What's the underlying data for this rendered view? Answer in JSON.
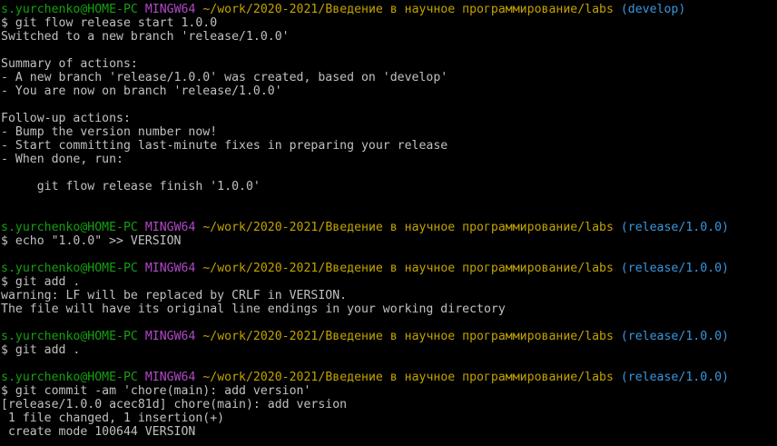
{
  "colors": {
    "background": "#000000",
    "text": "#c0c0c0",
    "user": "#13a10e",
    "host": "#b148c6",
    "path": "#c1a300",
    "branch": "#3a96dd"
  },
  "lines": [
    {
      "type": "prompt",
      "user": "s.yurchenko@HOME-PC",
      "host": "MINGW64",
      "path": "~/work/2020-2021/Введение в научное программирование/labs",
      "branch": "(develop)"
    },
    {
      "type": "cmd",
      "text": "$ git flow release start 1.0.0"
    },
    {
      "type": "out",
      "text": "Switched to a new branch 'release/1.0.0'"
    },
    {
      "type": "out",
      "text": ""
    },
    {
      "type": "out",
      "text": "Summary of actions:"
    },
    {
      "type": "out",
      "text": "- A new branch 'release/1.0.0' was created, based on 'develop'"
    },
    {
      "type": "out",
      "text": "- You are now on branch 'release/1.0.0'"
    },
    {
      "type": "out",
      "text": ""
    },
    {
      "type": "out",
      "text": "Follow-up actions:"
    },
    {
      "type": "out",
      "text": "- Bump the version number now!"
    },
    {
      "type": "out",
      "text": "- Start committing last-minute fixes in preparing your release"
    },
    {
      "type": "out",
      "text": "- When done, run:"
    },
    {
      "type": "out",
      "text": ""
    },
    {
      "type": "out",
      "text": "     git flow release finish '1.0.0'"
    },
    {
      "type": "out",
      "text": ""
    },
    {
      "type": "out",
      "text": ""
    },
    {
      "type": "prompt",
      "user": "s.yurchenko@HOME-PC",
      "host": "MINGW64",
      "path": "~/work/2020-2021/Введение в научное программирование/labs",
      "branch": "(release/1.0.0)"
    },
    {
      "type": "cmd",
      "text": "$ echo \"1.0.0\" >> VERSION"
    },
    {
      "type": "out",
      "text": ""
    },
    {
      "type": "prompt",
      "user": "s.yurchenko@HOME-PC",
      "host": "MINGW64",
      "path": "~/work/2020-2021/Введение в научное программирование/labs",
      "branch": "(release/1.0.0)"
    },
    {
      "type": "cmd",
      "text": "$ git add ."
    },
    {
      "type": "out",
      "text": "warning: LF will be replaced by CRLF in VERSION."
    },
    {
      "type": "out",
      "text": "The file will have its original line endings in your working directory"
    },
    {
      "type": "out",
      "text": ""
    },
    {
      "type": "prompt",
      "user": "s.yurchenko@HOME-PC",
      "host": "MINGW64",
      "path": "~/work/2020-2021/Введение в научное программирование/labs",
      "branch": "(release/1.0.0)"
    },
    {
      "type": "cmd",
      "text": "$ git add ."
    },
    {
      "type": "out",
      "text": ""
    },
    {
      "type": "prompt",
      "user": "s.yurchenko@HOME-PC",
      "host": "MINGW64",
      "path": "~/work/2020-2021/Введение в научное программирование/labs",
      "branch": "(release/1.0.0)"
    },
    {
      "type": "cmd",
      "text": "$ git commit -am 'chore(main): add version'"
    },
    {
      "type": "out",
      "text": "[release/1.0.0 acec81d] chore(main): add version"
    },
    {
      "type": "out",
      "text": " 1 file changed, 1 insertion(+)"
    },
    {
      "type": "out",
      "text": " create mode 100644 VERSION"
    }
  ]
}
